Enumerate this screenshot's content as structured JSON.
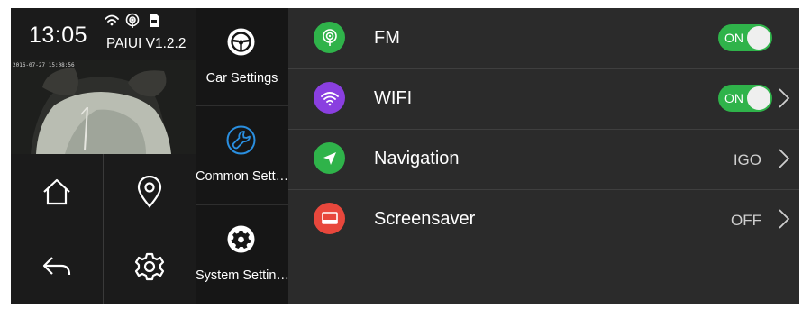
{
  "status": {
    "time": "13:05",
    "version": "PAIUI V1.2.2",
    "icons": [
      "wifi-icon",
      "hotspot-icon",
      "sd-card-icon"
    ]
  },
  "camera": {
    "timestamp": "2016-07-27 15:08:56"
  },
  "quick_buttons": [
    {
      "icon": "home-icon"
    },
    {
      "icon": "location-pin-icon"
    },
    {
      "icon": "back-arrow-icon"
    },
    {
      "icon": "gear-icon"
    }
  ],
  "categories": [
    {
      "label": "Car Settings",
      "icon": "steering-wheel-icon",
      "active": false
    },
    {
      "label": "Common Sett…",
      "icon": "wrench-icon",
      "active": true
    },
    {
      "label": "System Settin…",
      "icon": "gear-icon",
      "active": false
    }
  ],
  "settings": [
    {
      "label": "FM",
      "icon": "fm-radio-icon",
      "color": "#2fb34a",
      "control": "toggle",
      "toggle_label": "ON",
      "value": "",
      "chevron": false
    },
    {
      "label": "WIFI",
      "icon": "wifi-icon",
      "color": "#8a3fe0",
      "control": "toggle",
      "toggle_label": "ON",
      "value": "",
      "chevron": true
    },
    {
      "label": "Navigation",
      "icon": "navigation-arrow-icon",
      "color": "#2fb34a",
      "control": "value",
      "value": "IGO",
      "chevron": true
    },
    {
      "label": "Screensaver",
      "icon": "screensaver-icon",
      "color": "#e8473c",
      "control": "value",
      "value": "OFF",
      "chevron": true
    }
  ],
  "colors": {
    "accent_blue": "#2a8fe0",
    "toggle_on": "#2fb34a"
  }
}
